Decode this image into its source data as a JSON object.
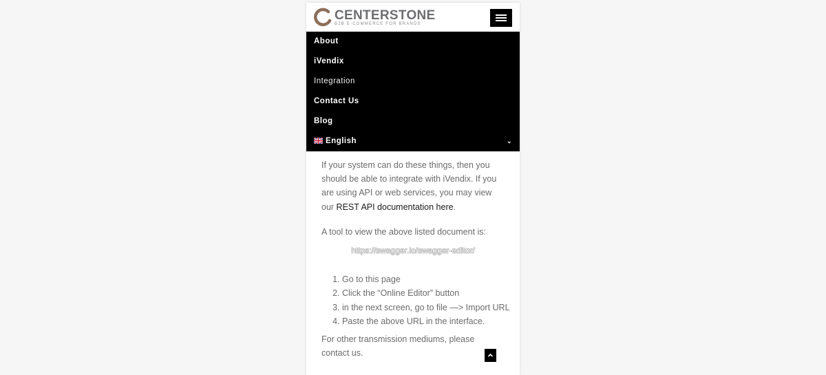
{
  "header": {
    "brand": "CENTERSTONE",
    "tagline": "B2B E-COMMERCE FOR BRANDS"
  },
  "menu": {
    "items": [
      {
        "label": "About"
      },
      {
        "label": "iVendix"
      },
      {
        "label": "Integration"
      },
      {
        "label": "Contact Us"
      },
      {
        "label": "Blog"
      }
    ],
    "language": {
      "label": "English",
      "caret": "⌄"
    }
  },
  "content": {
    "para1_text": "If your system can do these things, then you should be able to integrate with iVendix. If you are using API or web services, you may view our ",
    "para1_link": "REST API documentation here",
    "para1_end": ".",
    "para2": "A tool to view the above listed document is:",
    "url": "https://swagger.io/swagger-editor/",
    "steps": [
      "Go to this page",
      "Click the “Online Editor” button",
      "in the next screen, go to file —> Import URL",
      "Paste the above URL in the interface."
    ],
    "para3": "For other transmission mediums, please contact us."
  },
  "colors": {
    "menu_bg": "#000000",
    "accent": "#8b6e5a"
  }
}
